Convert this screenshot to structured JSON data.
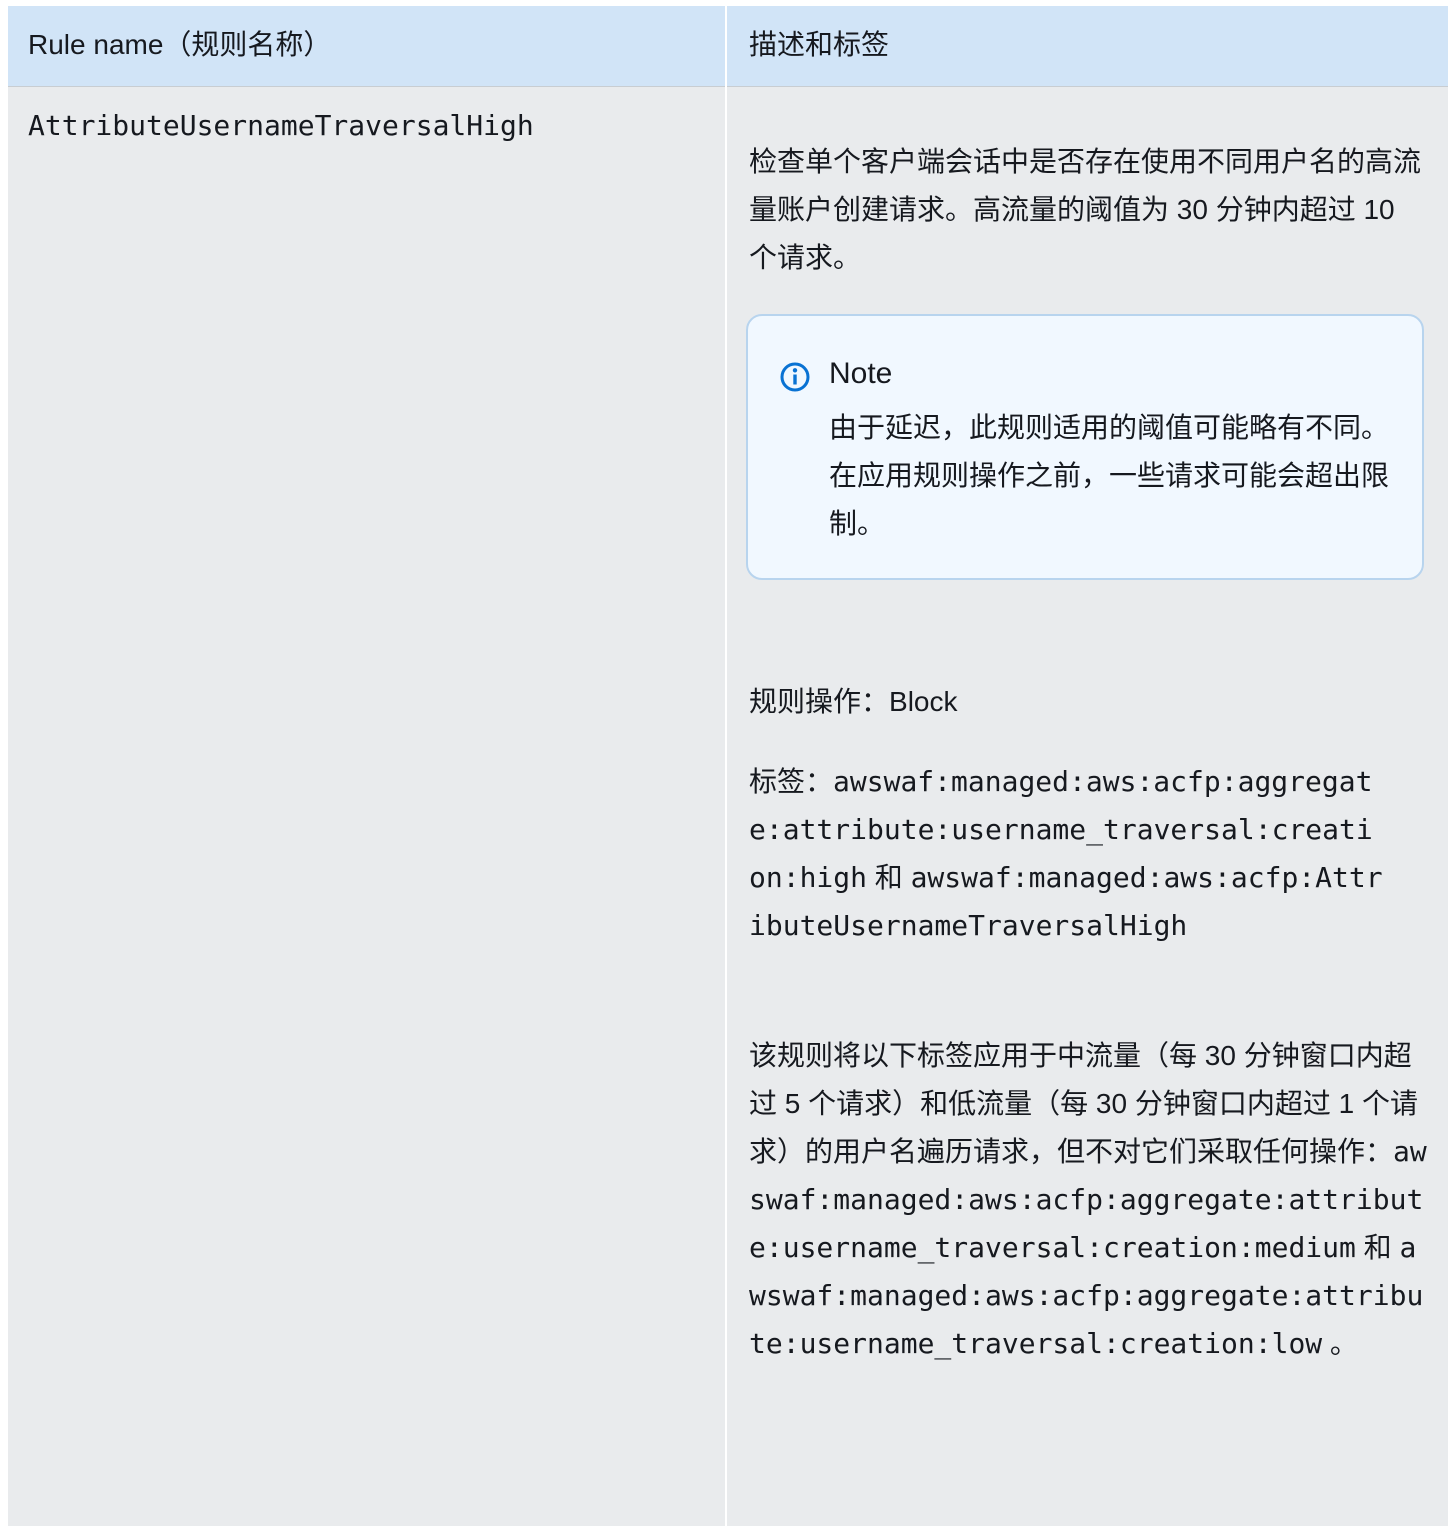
{
  "table": {
    "headers": [
      "Rule name（规则名称）",
      "描述和标签"
    ],
    "row": {
      "rule_name": "AttributeUsernameTraversalHigh",
      "description": "检查单个客户端会话中是否存在使用不同用户名的高流量账户创建请求。高流量的阈值为 30 分钟内超过 10 个请求。",
      "note": {
        "icon": "info-icon",
        "title": "Note",
        "body": "由于延迟，此规则适用的阈值可能略有不同。在应用规则操作之前，一些请求可能会超出限制。"
      },
      "action_prefix": "规则操作：",
      "action_value": "Block",
      "labels_prefix": "标签：",
      "label_1": "awswaf:managed:aws:acfp:aggregate:attribute:username_traversal:creation:high",
      "labels_joiner": " 和 ",
      "label_2": "awswaf:managed:aws:acfp:AttributeUsernameTraversalHigh",
      "extra_text": "该规则将以下标签应用于中流量（每 30 分钟窗口内超过 5 个请求）和低流量（每 30 分钟窗口内超过 1 个请求）的用户名遍历请求，但不对它们采取任何操作：",
      "extra_label_1": "awswaf:managed:aws:acfp:aggregate:attribute:username_traversal:creation:medium",
      "extra_joiner": " 和 ",
      "extra_label_2": "awswaf:managed:aws:acfp:aggregate:attribute:username_traversal:creation:low",
      "extra_end": " 。"
    }
  },
  "colors": {
    "header_bg": "#d1e4f7",
    "cell_bg": "#e9ebed",
    "note_bg": "#f1f8ff",
    "note_border": "#b8d4ee",
    "info_icon": "#0972d3"
  }
}
